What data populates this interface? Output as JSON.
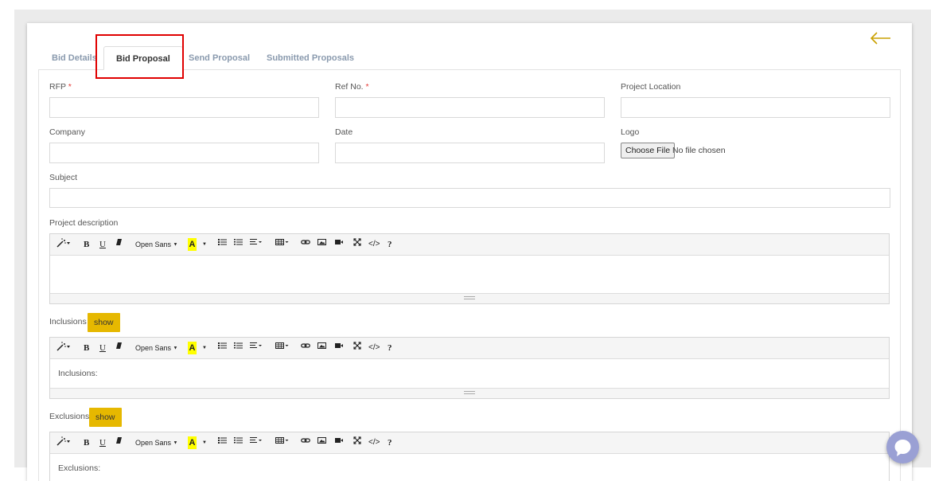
{
  "tabs": [
    {
      "label": "Bid Details"
    },
    {
      "label": "Bid Proposal"
    },
    {
      "label": "Send Proposal"
    },
    {
      "label": "Submitted Proposals"
    }
  ],
  "form": {
    "rfp_label": "RFP",
    "ref_label": "Ref No.",
    "required_mark": "*",
    "location_label": "Project Location",
    "company_label": "Company",
    "date_label": "Date",
    "logo_label": "Logo",
    "choose_file": "Choose File",
    "no_file": "No file chosen",
    "subject_label": "Subject",
    "description_label": "Project description",
    "inclusions_label": "Inclusions",
    "exclusions_label": "Exclusions",
    "show_label": "show"
  },
  "toolbar": {
    "font_name": "Open Sans",
    "bold": "B",
    "underline": "U",
    "color": "A",
    "help": "?",
    "code": "</>"
  },
  "editors": {
    "description_content": "",
    "inclusions_content": "Inclusions:",
    "exclusions_content": "Exclusions:"
  },
  "colors": {
    "accent": "#e6b800",
    "highlight": "#e00000",
    "tab_inactive": "#8a9aae"
  }
}
